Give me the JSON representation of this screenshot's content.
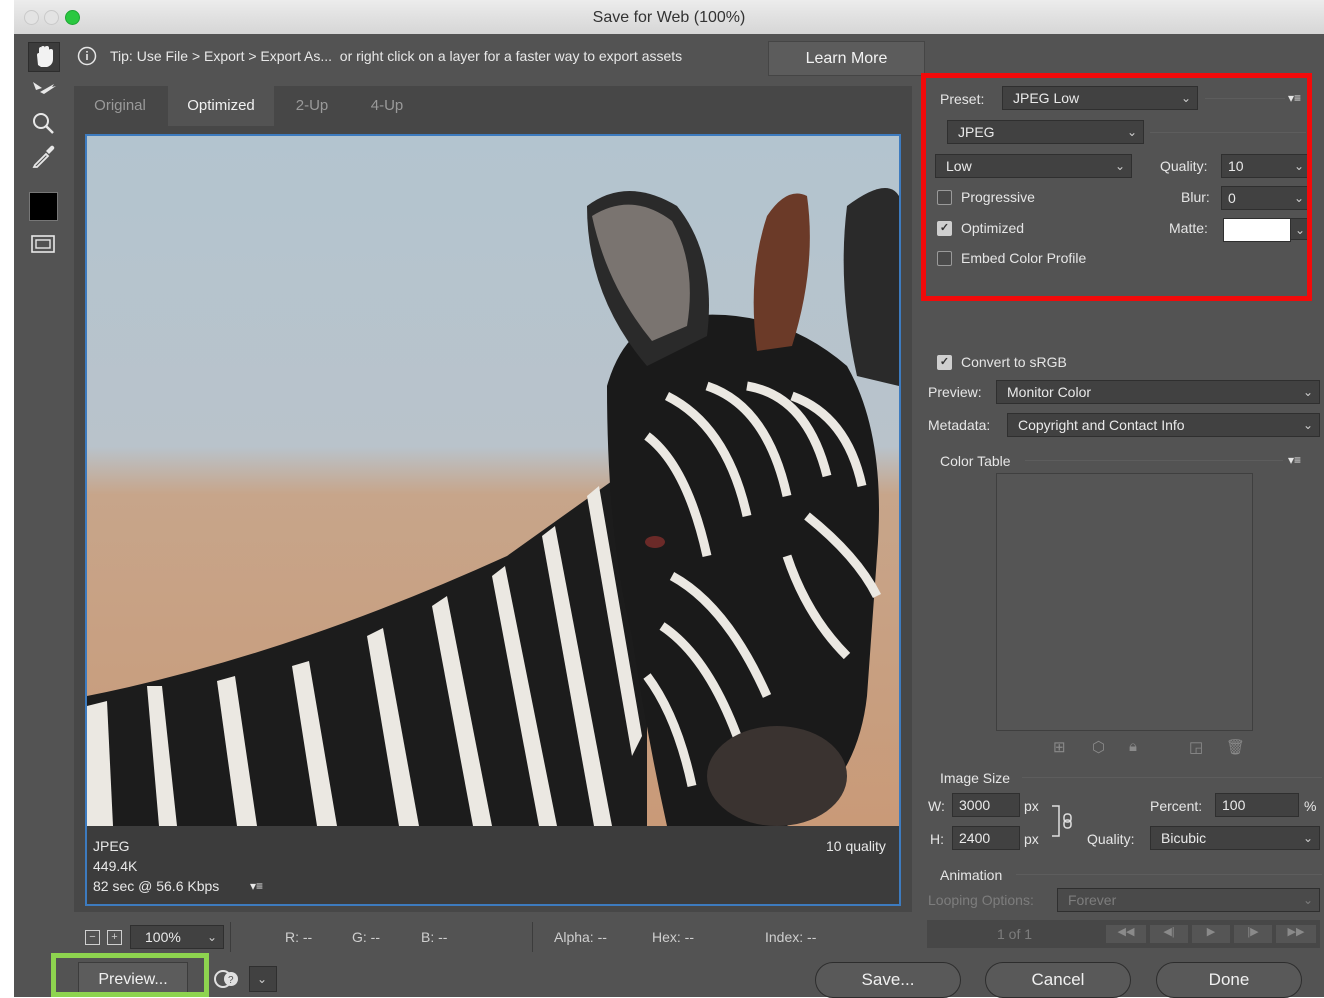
{
  "window": {
    "title": "Save for Web (100%)"
  },
  "tools": [
    {
      "name": "hand-tool-icon",
      "glyph": "✋"
    },
    {
      "name": "slice-select-icon",
      "glyph": "➶"
    },
    {
      "name": "zoom-icon",
      "glyph": "⌕"
    },
    {
      "name": "eyedropper-icon",
      "glyph": "✒"
    }
  ],
  "tip": {
    "text": "Tip: Use File > Export > Export As...  or right click on a layer for a faster way to export assets",
    "learn_more": "Learn More"
  },
  "tabs": [
    "Original",
    "Optimized",
    "2-Up",
    "4-Up"
  ],
  "active_tab": "Optimized",
  "image_info": {
    "format": "JPEG",
    "size": "449.4K",
    "download_time": "82 sec @ 56.6 Kbps",
    "quality_label": "10 quality"
  },
  "status": {
    "zoom": "100%",
    "r": "R: --",
    "g": "G: --",
    "b": "B: --",
    "alpha": "Alpha: --",
    "hex": "Hex: --",
    "index": "Index: --"
  },
  "settings": {
    "preset_label": "Preset:",
    "preset_value": "JPEG Low",
    "format_value": "JPEG",
    "quality_level": "Low",
    "quality_label": "Quality:",
    "quality_value": "10",
    "progressive": "Progressive",
    "progressive_checked": false,
    "blur_label": "Blur:",
    "blur_value": "0",
    "optimized": "Optimized",
    "optimized_checked": true,
    "matte_label": "Matte:",
    "matte_color": "#ffffff",
    "embed_profile": "Embed Color Profile",
    "embed_checked": false,
    "convert_srgb": "Convert to sRGB",
    "convert_checked": true,
    "preview_label": "Preview:",
    "preview_value": "Monitor Color",
    "metadata_label": "Metadata:",
    "metadata_value": "Copyright and Contact Info",
    "color_table": "Color Table"
  },
  "image_size": {
    "heading": "Image Size",
    "w_label": "W:",
    "w_value": "3000",
    "h_label": "H:",
    "h_value": "2400",
    "unit": "px",
    "percent_label": "Percent:",
    "percent_value": "100",
    "percent_unit": "%",
    "quality_label": "Quality:",
    "quality_value": "Bicubic"
  },
  "animation": {
    "heading": "Animation",
    "looping_label": "Looping Options:",
    "looping_value": "Forever",
    "frame_counter": "1 of 1"
  },
  "buttons": {
    "preview": "Preview...",
    "save": "Save...",
    "cancel": "Cancel",
    "done": "Done"
  },
  "colors": {
    "highlight_red": "#f20a0a",
    "highlight_green": "#8ed44f",
    "selection_blue": "#3d7bbf"
  }
}
